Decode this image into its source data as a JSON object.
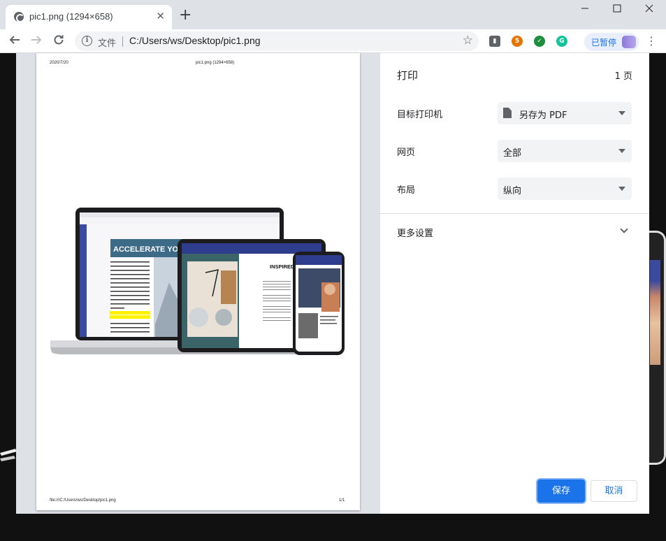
{
  "browser": {
    "tab_title": "pic1.png (1294×658)",
    "scheme_label": "文件",
    "url": "C:/Users/ws/Desktop/pic1.png",
    "profile_status": "已暂停",
    "window_controls": [
      "minimize-icon",
      "maximize-icon",
      "close-icon"
    ],
    "extensions": [
      {
        "name": "extension-icon-1",
        "color": "#5f6368"
      },
      {
        "name": "extension-icon-2",
        "color": "#e37400"
      },
      {
        "name": "extension-icon-3",
        "color": "#1e8e3e"
      },
      {
        "name": "grammarly-icon",
        "color": "#15c39a"
      }
    ]
  },
  "preview": {
    "header_date": "2020/7/20",
    "header_title": "pic1.png (1294×658)",
    "footer_url": "file:///C:/Users/ws/Desktop/pic1.png",
    "footer_page": "1/1",
    "image": {
      "banner": "ACCELERATE YOUR",
      "body_text": "In the world of business, your organizational effectiveness has a huge impact on how your perception by potential clients. If you are not able to organize your file system and documents, other businesses would be reluctant to strike deals with you.",
      "highlight": "It doesn't help if you always have papers flying around.",
      "body_text_2": "To resolve this, you can transition from paper to PDFs. Unlike Paper, PDF",
      "tablet_heading": "INSPIRED"
    }
  },
  "print": {
    "title": "打印",
    "page_count": "1 页",
    "destination_label": "目标打印机",
    "destination_value": "另存为 PDF",
    "pages_label": "网页",
    "pages_value": "全部",
    "layout_label": "布局",
    "layout_value": "纵向",
    "more_settings": "更多设置",
    "save_button": "保存",
    "cancel_button": "取消"
  }
}
